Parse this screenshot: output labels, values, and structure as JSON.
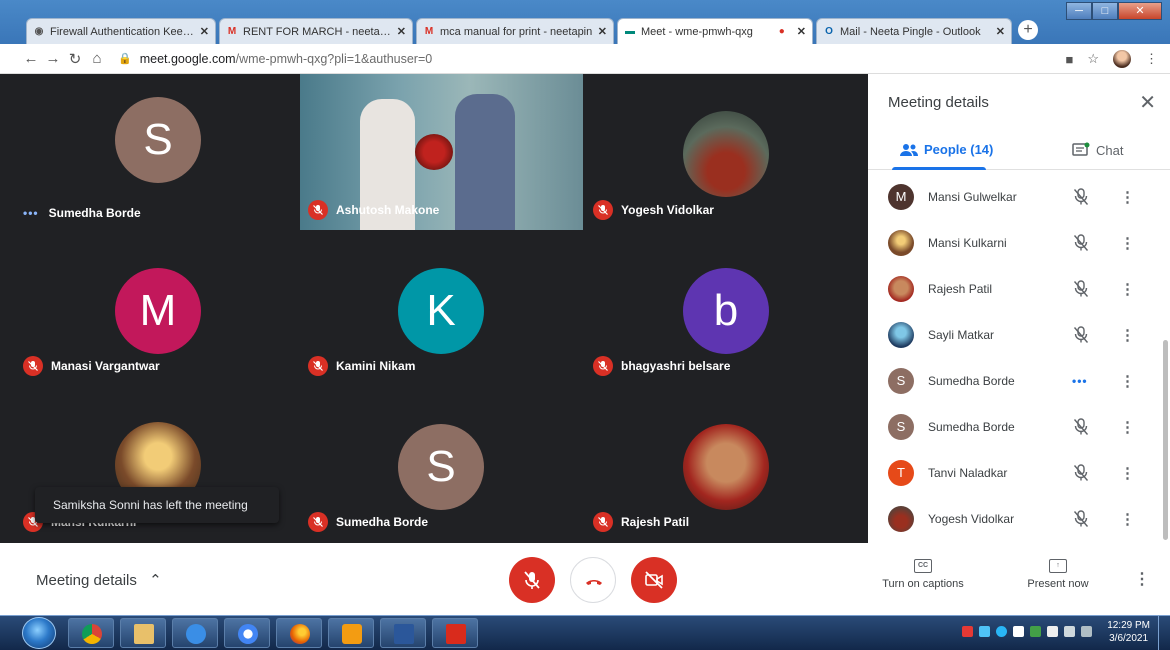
{
  "browser": {
    "tabs": [
      {
        "label": "Firewall Authentication Keepaliv",
        "favicon": "globe-icon",
        "active": false
      },
      {
        "label": "RENT FOR MARCH - neetapingl",
        "favicon": "gmail-icon",
        "active": false
      },
      {
        "label": "mca manual for print - neetapin",
        "favicon": "gmail-icon",
        "active": false
      },
      {
        "label": "Meet - wme-pmwh-qxg",
        "favicon": "meet-icon",
        "active": true
      },
      {
        "label": "Mail - Neeta Pingle - Outlook",
        "favicon": "outlook-icon",
        "active": false
      }
    ],
    "url_host": "meet.google.com",
    "url_path": "/wme-pmwh-qxg?pli=1&authuser=0"
  },
  "tiles": [
    {
      "name": "Sumedha Borde",
      "initial": "S",
      "avatar_color": "#8d6e63",
      "status": "speaking"
    },
    {
      "name": "Ashutosh Makone",
      "initial": "",
      "avatar_color": "",
      "status": "muted"
    },
    {
      "name": "Yogesh Vidolkar",
      "initial": "",
      "avatar_color": "",
      "status": "muted"
    },
    {
      "name": "Manasi Vargantwar",
      "initial": "M",
      "avatar_color": "#c2185b",
      "status": "muted"
    },
    {
      "name": "Kamini Nikam",
      "initial": "K",
      "avatar_color": "#0097a7",
      "status": "muted"
    },
    {
      "name": "bhagyashri belsare",
      "initial": "b",
      "avatar_color": "#5e35b1",
      "status": "muted"
    },
    {
      "name": "Mansi Kulkarni",
      "initial": "",
      "avatar_color": "",
      "status": "muted"
    },
    {
      "name": "Sumedha Borde",
      "initial": "S",
      "avatar_color": "#8d6e63",
      "status": "muted"
    },
    {
      "name": "Rajesh Patil",
      "initial": "",
      "avatar_color": "",
      "status": "muted"
    }
  ],
  "toast": "Samiksha Sonni has left the meeting",
  "panel": {
    "title": "Meeting details",
    "people_tab": "People (14)",
    "chat_tab": "Chat",
    "participants": [
      {
        "name": "Mansi Gulwelkar",
        "initial": "M",
        "color": "#4e342e",
        "status": "muted"
      },
      {
        "name": "Mansi Kulkarni",
        "initial": "",
        "color": "#7a4a2a",
        "status": "muted"
      },
      {
        "name": "Rajesh Patil",
        "initial": "",
        "color": "#a1887f",
        "status": "muted"
      },
      {
        "name": "Sayli Matkar",
        "initial": "",
        "color": "#1e3a5f",
        "status": "muted"
      },
      {
        "name": "Sumedha Borde",
        "initial": "S",
        "color": "#8d6e63",
        "status": "speaking"
      },
      {
        "name": "Sumedha Borde",
        "initial": "S",
        "color": "#8d6e63",
        "status": "muted"
      },
      {
        "name": "Tanvi Naladkar",
        "initial": "T",
        "color": "#e64a19",
        "status": "muted"
      },
      {
        "name": "Yogesh Vidolkar",
        "initial": "",
        "color": "#5d4037",
        "status": "muted"
      }
    ]
  },
  "bottom": {
    "meeting_details": "Meeting details",
    "captions": "Turn on captions",
    "present": "Present now"
  },
  "taskbar": {
    "time": "12:29 PM",
    "date": "3/6/2021"
  }
}
